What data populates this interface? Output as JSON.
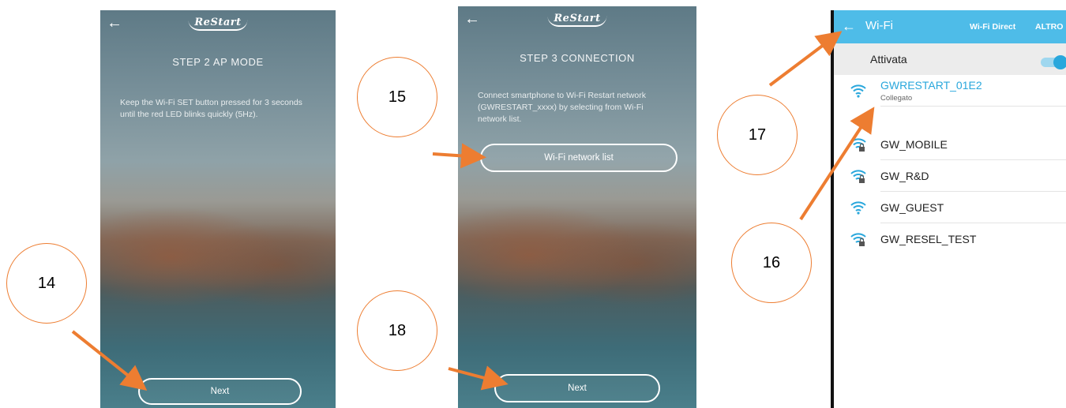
{
  "colors": {
    "accent": "#29a7dc",
    "appbar": "#4ebce8",
    "callout": "#ed7d31"
  },
  "screen1": {
    "back_icon": "←",
    "logo": "ReStart",
    "title": "STEP 2 AP MODE",
    "description": "Keep the Wi-Fi SET button pressed for 3 seconds until the red LED blinks quickly (5Hz).",
    "next_label": "Next"
  },
  "screen2": {
    "back_icon": "←",
    "logo": "ReStart",
    "title": "STEP 3 CONNECTION",
    "description": "Connect smartphone to Wi-Fi Restart network (GWRESTART_xxxx) by selecting from Wi-Fi network list.",
    "wifi_list_label": "Wi-Fi network list",
    "next_label": "Next"
  },
  "wifi_screen": {
    "back_icon": "←",
    "title": "Wi-Fi",
    "wifi_direct": "Wi-Fi Direct",
    "more": "ALTRO",
    "toggle_label": "Attivata",
    "toggle_on": true,
    "networks": [
      {
        "name": "GWRESTART_01E2",
        "status": "Collegato",
        "locked": false,
        "icon": "wifi-icon"
      },
      {
        "name": "GW_MOBILE",
        "locked": true,
        "icon": "wifi-lock-icon"
      },
      {
        "name": "GW_R&D",
        "locked": true,
        "icon": "wifi-lock-icon"
      },
      {
        "name": "GW_GUEST",
        "locked": false,
        "icon": "wifi-icon"
      },
      {
        "name": "GW_RESEL_TEST",
        "locked": true,
        "icon": "wifi-lock-icon"
      }
    ]
  },
  "callouts": {
    "c14": "14",
    "c15": "15",
    "c16": "16",
    "c17": "17",
    "c18": "18"
  }
}
